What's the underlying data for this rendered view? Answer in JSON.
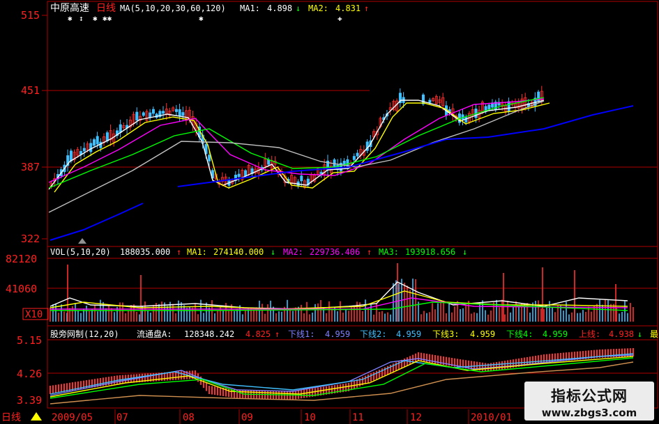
{
  "colors": {
    "frame": "#b00000",
    "ma5": "#ffffff",
    "ma10": "#ffff00",
    "ma20": "#ff00ff",
    "ma30": "#00ff00",
    "ma60": "#c0c0c0",
    "ma120": "#0000ff",
    "candle_up": "#ff3030",
    "candle_down": "#40c0ff"
  },
  "price_panel": {
    "title": "中原高速",
    "period": "日线",
    "indicator": "MA(5,10,20,30,60,120)",
    "ma1_label": "MA1:",
    "ma1_value": "4.898",
    "ma1_arrow": "↓",
    "ma2_label": "MA2:",
    "ma2_value": "4.831",
    "ma2_arrow": "↑",
    "yaxis_labels": [
      "515",
      "451",
      "387",
      "322"
    ]
  },
  "volume_panel": {
    "indicator": "VOL(5,10,20)",
    "vol_value": "188035.000",
    "vol_arrow": "↑",
    "ma1_label": "MA1:",
    "ma1_value": "274140.000",
    "ma1_arrow": "↓",
    "ma2_label": "MA2:",
    "ma2_value": "229736.406",
    "ma2_arrow": "↑",
    "ma3_label": "MA3:",
    "ma3_value": "193918.656",
    "ma3_arrow": "↓",
    "yaxis_labels": [
      "82120",
      "41060",
      "X10"
    ]
  },
  "indicator_panel": {
    "indicator": "股旁网制(12,20)",
    "float_label": "流通盘A:",
    "float_value": "128348.242",
    "v0": "4.825",
    "v0_arrow": "↑",
    "l1_label": "下线1:",
    "l1_value": "4.959",
    "l2_label": "下线2:",
    "l2_value": "4.959",
    "l3_label": "下线3:",
    "l3_value": "4.959",
    "l4_label": "下线4:",
    "l4_value": "4.959",
    "up_label": "上线:",
    "up_value": "4.938",
    "up_arrow": "↓",
    "tail": "最",
    "yaxis_labels": [
      "5.15",
      "4.26",
      "3.39"
    ]
  },
  "time_axis": {
    "period_tab": "日线",
    "labels": [
      "2009/05",
      "07",
      "08",
      "09",
      "10",
      "11",
      "12",
      "2010/01"
    ]
  },
  "watermark": {
    "line1": "指标公式网",
    "line2": "www.zbgs3.com"
  }
}
